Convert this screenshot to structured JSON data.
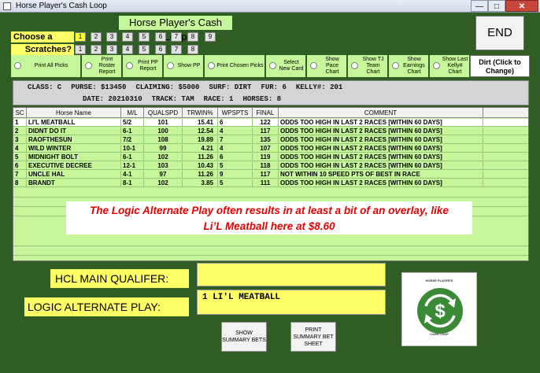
{
  "window": {
    "title": "Horse Player's Cash Loop",
    "min_glyph": "—",
    "max_glyph": "□",
    "close_glyph": "✕"
  },
  "app_title": "Horse Player's Cash Loop",
  "choose_race": {
    "label": "Choose  a race:",
    "buttons": [
      "1",
      "2",
      "3",
      "4",
      "5",
      "6",
      "7",
      "8",
      "9"
    ],
    "selected": "1"
  },
  "scratches": {
    "label": "Scratches?",
    "buttons": [
      "1",
      "2",
      "3",
      "4",
      "5",
      "6",
      "7",
      "8"
    ]
  },
  "end_button": "END",
  "options": [
    "Print All Picks",
    "Print Roster Report",
    "Print PP Report",
    "Show   PP",
    "Print Chosen Picks",
    "Select New Card",
    "Show Pace Chart",
    "Show TJ Team Chart",
    "Show Earnings Chart",
    "Show Last Kelly# Chart"
  ],
  "dirt_button": "Dirt (Click to Change)",
  "race_info": {
    "class": "CLASS: C",
    "purse": "PURSE: $13450",
    "claiming": "CLAIMING: $5000",
    "surf": "SURF: DIRT",
    "fur": "FUR: 6",
    "kelly": "KELLY#: 201",
    "date": "DATE: 20210310",
    "track": "TRACK: TAM",
    "race": "RACE: 1",
    "horses": "HORSES: 8"
  },
  "table": {
    "headers": [
      "SC",
      "Horse Name",
      "M/L",
      "QUALSPD",
      "TRWIN%",
      "WPSPTS",
      "FINAL",
      "COMMENT"
    ],
    "rows": [
      [
        "1",
        "LI'L MEATBALL",
        "5/2",
        "101",
        "15.41",
        "6",
        "122",
        "ODDS TOO HIGH IN LAST 2 RACES [WITHIN 60 DAYS]"
      ],
      [
        "2",
        "DIDNT DO IT",
        "6-1",
        "100",
        "12.54",
        "4",
        "117",
        "ODDS TOO HIGH IN LAST 2 RACES [WITHIN 60 DAYS]"
      ],
      [
        "3",
        "RAOFTHESUN",
        "7/2",
        "108",
        "19.89",
        "7",
        "135",
        "ODDS TOO HIGH IN LAST 2 RACES [WITHIN 60 DAYS]"
      ],
      [
        "4",
        "WILD WINTER",
        "10-1",
        "99",
        "4.21",
        "4",
        "107",
        "ODDS TOO HIGH IN LAST 2 RACES [WITHIN 60 DAYS]"
      ],
      [
        "5",
        "MIDNIGHT BOLT",
        "6-1",
        "102",
        "11.26",
        "6",
        "119",
        "ODDS TOO HIGH IN LAST 2 RACES [WITHIN 60 DAYS]"
      ],
      [
        "6",
        "EXECUTIVE DECREE",
        "12-1",
        "103",
        "10.43",
        "5",
        "118",
        "ODDS TOO HIGH IN LAST 2 RACES [WITHIN 60 DAYS]"
      ],
      [
        "7",
        "UNCLE HAL",
        "4-1",
        "97",
        "11.26",
        "9",
        "117",
        "NOT WITHIN 10 SPEED PTS OF BEST IN RACE"
      ],
      [
        "8",
        "BRANDT",
        "8-1",
        "102",
        "3.85",
        "5",
        "111",
        "ODDS TOO HIGH IN LAST 2 RACES [WITHIN 60 DAYS]"
      ]
    ]
  },
  "banner_line1": "The Logic Alternate Play often results in at least a bit of an overlay, like",
  "banner_line2": "Li’L Meatball here at $8.60",
  "hcl_label": "HCL MAIN QUALIFER:",
  "hcl_value": "",
  "lap_label": "LOGIC ALTERNATE PLAY:",
  "lap_value": "1   LI'L MEATBALL",
  "show_summary_button": "SHOW SUMMARY BETS",
  "print_summary_button": "PRINT SUMMARY BET SHEET",
  "logo": {
    "top_text": "HORSE PLAYER'S",
    "bottom_text": "CASH LOOP",
    "symbol": "$",
    "icon": "cash-loop-logo",
    "colors": {
      "ring": "#3a8a35",
      "text": "#ffffff"
    }
  }
}
